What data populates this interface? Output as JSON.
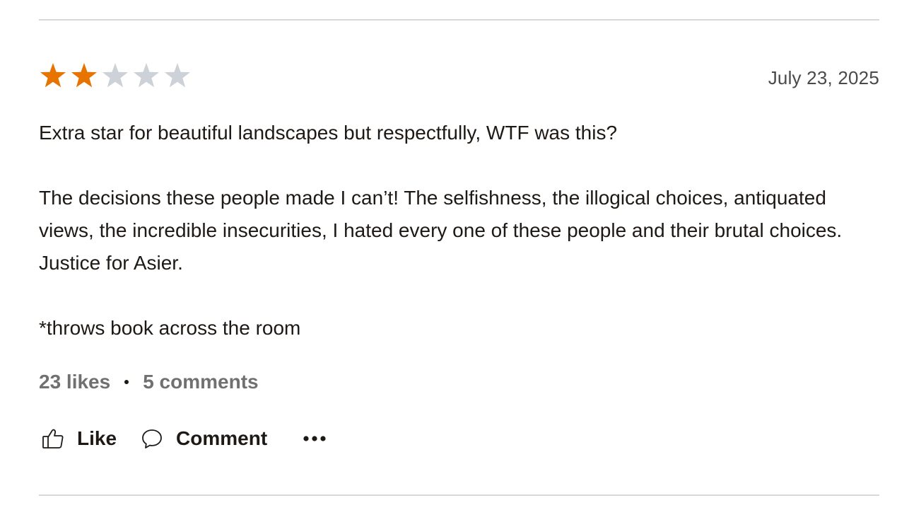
{
  "review": {
    "rating": 2,
    "max_rating": 5,
    "colors": {
      "star_filled": "#e87400",
      "star_empty": "#cdd2d8"
    },
    "date": "July 23, 2025",
    "paragraphs": [
      "Extra star for beautiful landscapes but respectfully, WTF was this?",
      "The decisions these people made I can’t! The selfishness, the illogical choices, antiquated views, the incredible insecurities, I hated every one of these people and their brutal choices. Justice for Asier.",
      "*throws book across the room"
    ],
    "stats": {
      "likes": "23 likes",
      "comments": "5 comments"
    },
    "actions": {
      "like_label": "Like",
      "like_icon": "thumbs-up-icon",
      "comment_label": "Comment",
      "comment_icon": "speech-bubble-icon",
      "more_icon": "more-options-icon"
    }
  }
}
